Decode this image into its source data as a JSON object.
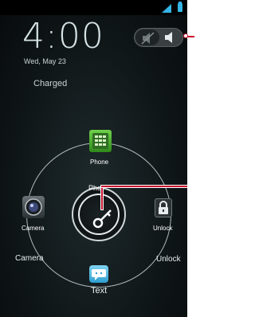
{
  "status_bar": {
    "signal_icon": "signal-bars-icon",
    "battery_icon": "battery-icon",
    "accent": "#35b5e5"
  },
  "lock_screen": {
    "time": "4:00",
    "date": "Wed, May 23",
    "charge_status": "Charged",
    "sound_toggle": {
      "mute_icon": "speaker-muted-icon",
      "sound_icon": "speaker-icon"
    },
    "unlock_handle": {
      "hint": "Phor",
      "icon": "key-icon"
    },
    "targets": {
      "phone": {
        "label": "Phone",
        "icon": "phone-keypad-icon"
      },
      "camera": {
        "label": "Camera",
        "outer_label": "Camera",
        "icon": "camera-icon"
      },
      "unlock": {
        "label": "Unlock",
        "outer_label": "Unlock",
        "icon": "padlock-icon"
      },
      "text": {
        "label": "Text",
        "icon": "chat-bubble-icon"
      }
    }
  },
  "callout_color": "#c8102e"
}
